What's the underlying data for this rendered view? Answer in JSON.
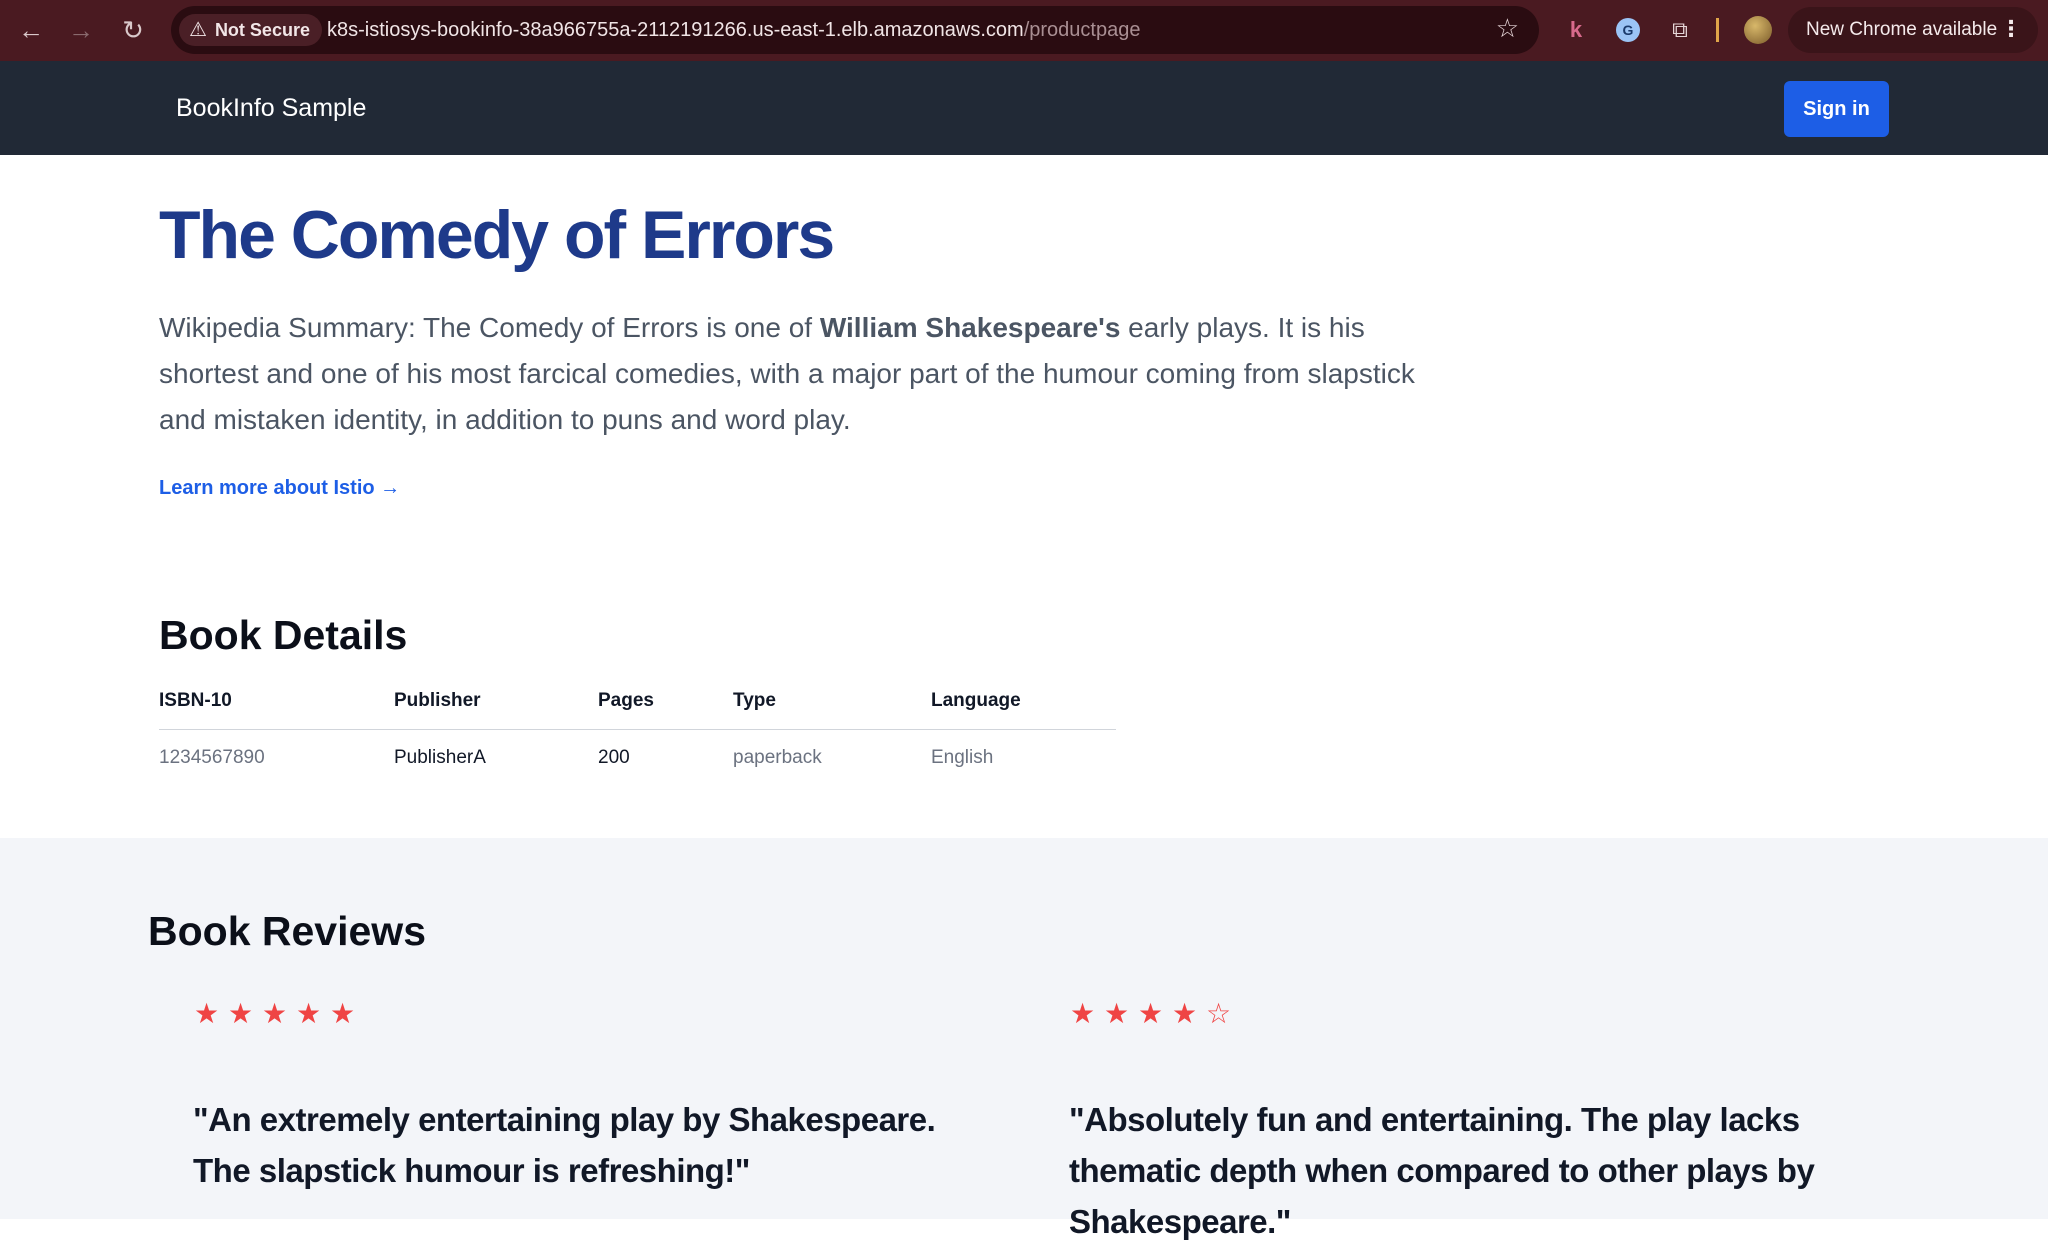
{
  "browser": {
    "security_label": "Not Secure",
    "url_host": "k8s-istiosys-bookinfo-38a966755a-2112191266.us-east-1.elb.amazonaws.com",
    "url_path": "/productpage",
    "update_label": "New Chrome available"
  },
  "header": {
    "brand": "BookInfo Sample",
    "signin_label": "Sign in"
  },
  "hero": {
    "title": "The Comedy of Errors",
    "summary_before": "Wikipedia Summary: The Comedy of Errors is one of ",
    "summary_bold": "William Shakespeare's",
    "summary_after": " early plays. It is his shortest and one of his most farcical comedies, with a major part of the humour coming from slapstick and mistaken identity, in addition to puns and word play.",
    "learn_more": "Learn more about Istio →"
  },
  "details": {
    "title": "Book Details",
    "columns": [
      "ISBN-10",
      "Publisher",
      "Pages",
      "Type",
      "Language"
    ],
    "row": [
      "1234567890",
      "PublisherA",
      "200",
      "paperback",
      "English"
    ]
  },
  "reviews": {
    "title": "Book Reviews",
    "items": [
      {
        "rating": 5,
        "max": 5,
        "text": "\"An extremely entertaining play by Shakespeare. The slapstick humour is refreshing!\""
      },
      {
        "rating": 4,
        "max": 5,
        "text": "\"Absolutely fun and entertaining. The play lacks thematic depth when compared to other plays by Shakespeare.\""
      }
    ]
  },
  "colors": {
    "chrome_bg": "#4a1a21",
    "header_bg": "#212936",
    "accent": "#1d5ee6",
    "title": "#1e3a8a",
    "star": "#ef4444"
  }
}
